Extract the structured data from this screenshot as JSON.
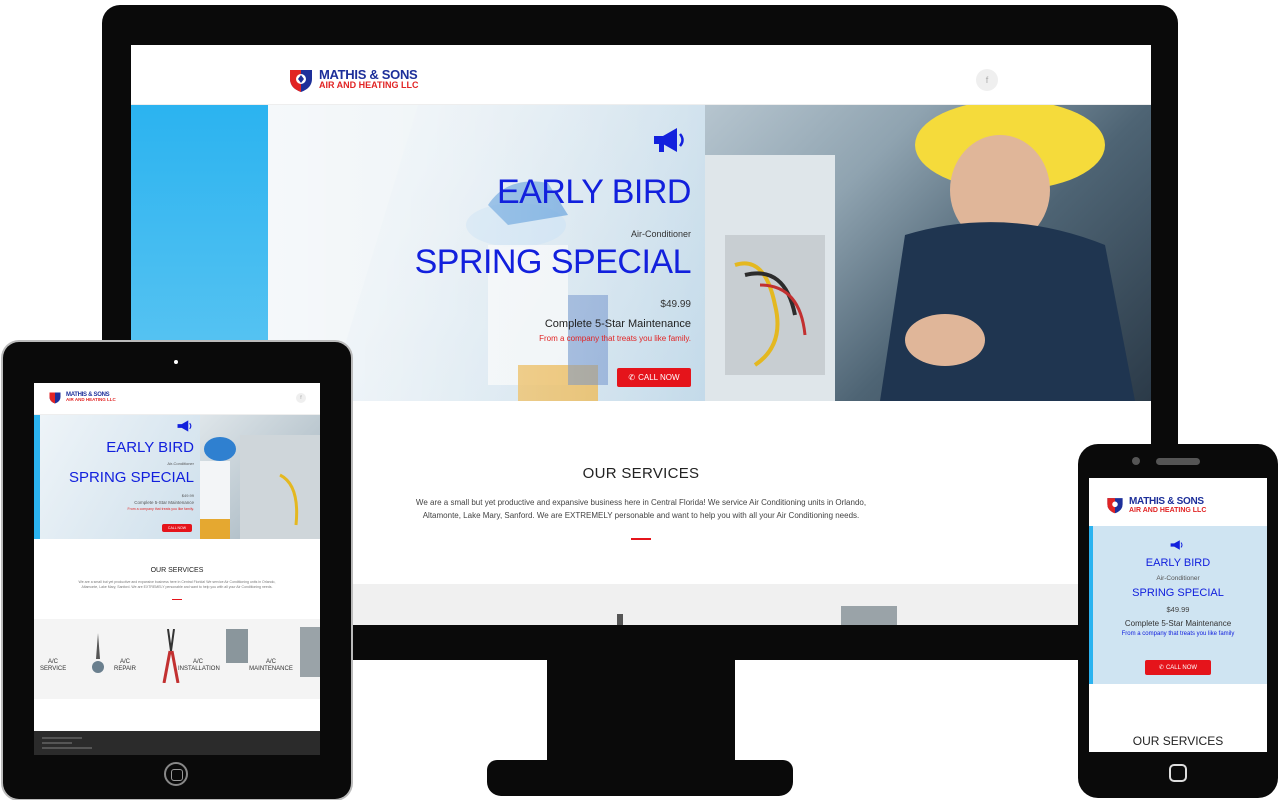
{
  "brand": {
    "line1": "MATHIS & SONS",
    "line2": "AIR AND HEATING LLC",
    "primary_color": "#1220dd",
    "accent_color": "#e5141b"
  },
  "social": {
    "facebook_icon": "f"
  },
  "hero": {
    "icon": "megaphone-icon",
    "headline": "EARLY BIRD",
    "eyebrow": "Air-Conditioner",
    "subheadline": "SPRING SPECIAL",
    "price": "$49.99",
    "service": "Complete 5-Star Maintenance",
    "tagline": "From a company that treats you like family.",
    "cta": "CALL NOW",
    "cta_icon": "phone-icon"
  },
  "services": {
    "title": "OUR SERVICES",
    "body_line1": "We are a small but yet productive and expansive business here in Central Florida! We service Air Conditioning units in Orlando,",
    "body_line2": "Altamonte, Lake Mary, Sanford. We are EXTREMELY personable and want to help you with all your Air Conditioning needs.",
    "items": [
      {
        "label_top": "A/C",
        "label_bottom": "SERVICE"
      },
      {
        "label_top": "A/C",
        "label_bottom": "REPAIR"
      },
      {
        "label_top": "A/C",
        "label_bottom": "INSTALLATION"
      },
      {
        "label_top": "A/C",
        "label_bottom": "MAINTENANCE"
      }
    ]
  },
  "phone": {
    "tagline": "From a company that treats you like family"
  }
}
